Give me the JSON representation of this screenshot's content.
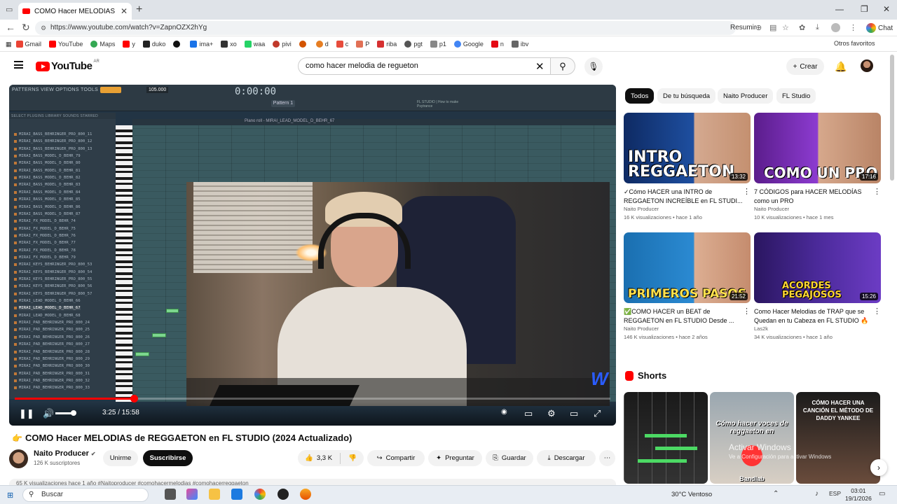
{
  "browser": {
    "tab_title": "COMO Hacer MELODIAS de RE",
    "url": "https://www.youtube.com/watch?v=ZapnOZX2hYg",
    "resumir": "Resumir",
    "chat": "Chat",
    "bookmarks": [
      "Gmail",
      "YouTube",
      "Maps",
      "y",
      "duko",
      "",
      "ima+",
      "xo",
      "waa",
      "pivi",
      "",
      "d",
      "c",
      "P",
      "riba",
      "pgt",
      "p1",
      "Google",
      "n",
      "ibv"
    ],
    "other_bookmarks": "Otros favoritos"
  },
  "youtube": {
    "logo": "YouTube",
    "country": "AR",
    "search_value": "como hacer melodia de regueton",
    "create": "Crear"
  },
  "video": {
    "fl": {
      "menu": "PATTERNS VIEW OPTIONS TOOLS HELP",
      "time": "0:00:00",
      "pattern": "Pattern 1",
      "browser_tabs": "SELECT   PLUGINS   LIBRARY   SOUNDS   STARRED",
      "pianoroll_title": "Piano roll - MIRAI_LEAD_MODEL_D_BEHR_67",
      "tempo": "105.000",
      "hint": "FL STUDIO | How to make Psytrance",
      "browser_items": [
        "MIRAI_BASS_BEHRINGER_PRO_800_11",
        "MIRAI_BASS_BEHRINGER_PRO_800_12",
        "MIRAI_BASS_BEHRINGER_PRO_800_13",
        "MIRAI_BASS_MODEL_D_BEHR_79",
        "MIRAI_BASS_MODEL_D_BEHR_80",
        "MIRAI_BASS_MODEL_D_BEHR_81",
        "MIRAI_BASS_MODEL_D_BEHR_82",
        "MIRAI_BASS_MODEL_D_BEHR_83",
        "MIRAI_BASS_MODEL_D_BEHR_84",
        "MIRAI_BASS_MODEL_D_BEHR_85",
        "MIRAI_BASS_MODEL_D_BEHR_86",
        "MIRAI_BASS_MODEL_D_BEHR_87",
        "MIRAI_FX_MODEL_D_BEHR_74",
        "MIRAI_FX_MODEL_D_BEHR_75",
        "MIRAI_FX_MODEL_D_BEHR_76",
        "MIRAI_FX_MODEL_D_BEHR_77",
        "MIRAI_FX_MODEL_D_BEHR_78",
        "MIRAI_FX_MODEL_D_BEHR_79",
        "MIRAI_KEYS_BEHRINGER_PRO_800_53",
        "MIRAI_KEYS_BEHRINGER_PRO_800_54",
        "MIRAI_KEYS_BEHRINGER_PRO_800_55",
        "MIRAI_KEYS_BEHRINGER_PRO_800_56",
        "MIRAI_KEYS_BEHRINGER_PRO_800_57",
        "MIRAI_LEAD_MODEL_D_BEHR_66",
        "MIRAI_LEAD_MODEL_D_BEHR_67",
        "MIRAI_LEAD_MODEL_D_BEHR_68",
        "MIRAI_PAD_BEHRINGER_PRO_800_24",
        "MIRAI_PAD_BEHRINGER_PRO_800_25",
        "MIRAI_PAD_BEHRINGER_PRO_800_26",
        "MIRAI_PAD_BEHRINGER_PRO_800_27",
        "MIRAI_PAD_BEHRINGER_PRO_800_28",
        "MIRAI_PAD_BEHRINGER_PRO_800_29",
        "MIRAI_PAD_BEHRINGER_PRO_800_30",
        "MIRAI_PAD_BEHRINGER_PRO_800_31",
        "MIRAI_PAD_BEHRINGER_PRO_800_32",
        "MIRAI_PAD_BEHRINGER_PRO_800_33"
      ]
    },
    "current_time": "3:25 / 15:58",
    "progress_fraction": 0.2,
    "title": "COMO Hacer MELODIAS de REGGAETON en FL STUDIO (2024 Actualizado)",
    "channel": "Naito Producer",
    "subscribers": "126 K suscriptores",
    "join": "Unirme",
    "subscribe": "Suscribirse",
    "likes": "3,3 K",
    "share": "Compartir",
    "ask": "Preguntar",
    "save": "Guardar",
    "download": "Descargar",
    "description": "65 K visualizaciones  hace 1 año  #Naitoproducer #comohacermelodias #comohacerreggaeton"
  },
  "sidebar": {
    "chips": [
      "Todos",
      "De tu búsqueda",
      "Naito Producer",
      "FL Studio"
    ],
    "videos": [
      {
        "title": "✓Cómo HACER una INTRO de REGGAETON INCREÍBLE en FL STUDI...",
        "channel": "Naito Producer",
        "meta": "16 K visualizaciones • hace 1 año",
        "duration": "13:32",
        "thumb_text": "INTRO REGGAETON"
      },
      {
        "title": "7 CÓDIGOS para HACER MELODÍAS como un PRO",
        "channel": "Naito Producer",
        "meta": "10 K visualizaciones • hace 1 mes",
        "duration": "17:16",
        "thumb_text": "COMO UN PRO"
      },
      {
        "title": "✅COMO HACER un BEAT de REGGAETON en FL STUDIO Desde ...",
        "channel": "Naito Producer",
        "meta": "146 K visualizaciones • hace 2 años",
        "duration": "21:52",
        "thumb_text": "PRIMEROS PASOS"
      },
      {
        "title": "Como Hacer Melodias de TRAP que se Quedan en tu Cabeza en FL STUDIO 🔥",
        "channel": "Las2k",
        "meta": "34 K visualizaciones • hace 1 año",
        "duration": "15:26",
        "thumb_text": "ACORDES PEGAJOSOS"
      }
    ],
    "shorts_header": "Shorts",
    "shorts": [
      {
        "text": ""
      },
      {
        "text": "Cómo hacer voces de reggaeton en",
        "caption": "Bandlab"
      },
      {
        "text": "CÓMO HACER UNA CANCIÓN EL MÉTODO DE DADDY YANKEE"
      }
    ],
    "activate_windows": "Activar Windows",
    "activate_windows_sub": "Ve a Configuración para activar Windows"
  },
  "taskbar": {
    "search": "Buscar",
    "weather": "30°C  Ventoso",
    "lang": "ESP",
    "time": "03:01",
    "date": "19/1/2026"
  },
  "colors": {
    "youtube_red": "#ff0000",
    "subscribe_bg": "#0f0f0f",
    "fl_bg": "#2d3a44"
  }
}
